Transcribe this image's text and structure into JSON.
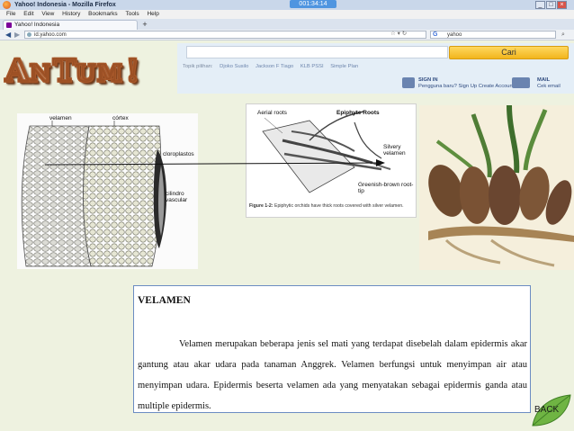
{
  "browser": {
    "window_title": "Yahoo! Indonesia - Mozilla Firefox",
    "timer": "001:34:14",
    "menu": [
      "File",
      "Edit",
      "View",
      "History",
      "Bookmarks",
      "Tools",
      "Help"
    ],
    "tab_title": "Yahoo! Indonesia",
    "new_tab": "+",
    "url": "id.yahoo.com",
    "search_value": "yahoo",
    "search_engine_icon": "G",
    "window_buttons": [
      "_",
      "□",
      "×"
    ]
  },
  "logo": "AnTum!",
  "yahoo": {
    "search_button": "Cari",
    "topics_label": "Topik pilihan:",
    "topics": [
      "Djoko Susilo",
      "Jackson F Tiago",
      "KLB PSSI",
      "Simple Plan"
    ],
    "signin_title": "SIGN IN",
    "signin_sub": "Pengguna baru? Sign Up",
    "create_account": "Create Account",
    "mail_title": "MAIL",
    "mail_sub": "Cek email"
  },
  "diagram_left": {
    "labels": {
      "velamen": "velamen",
      "cortex": "córtex",
      "cloroplastos": "cloroplastos",
      "cilindro": "cilindro vascular"
    }
  },
  "diagram_mid": {
    "aerial_roots": "Aerial roots",
    "epiphyte_roots": "Epiphyte Roots",
    "silvery_velamen": "Silvery velamen",
    "root_tip": "Greenish-brown root-tip",
    "caption_label": "Figure 1-2:",
    "caption": "Epiphytic orchids have thick roots covered with silver velamen."
  },
  "content": {
    "title": "VELAMEN",
    "paragraph": "Velamen merupakan beberapa jenis sel mati yang terdapat disebelah dalam epidermis akar gantung atau akar udara pada tanaman Anggrek. Velamen berfungsi untuk menyimpan air atau menyimpan udara. Epidermis beserta velamen ada yang menyatakan sebagai epidermis ganda atau multiple epidermis."
  },
  "back_button": "BACK"
}
